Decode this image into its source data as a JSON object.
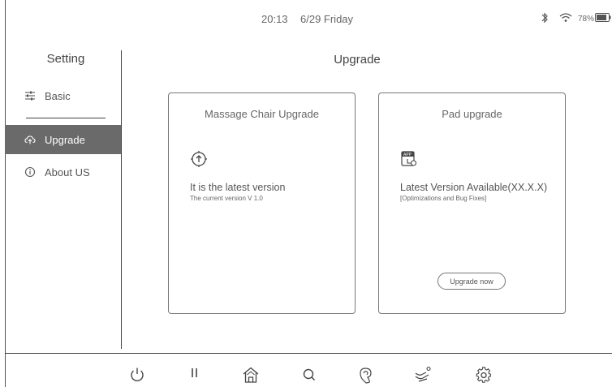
{
  "status": {
    "time": "20:13",
    "date": "6/29 Friday",
    "battery": "78%"
  },
  "sidebar": {
    "title": "Setting",
    "items": [
      {
        "label": "Basic",
        "icon": "sliders-icon"
      },
      {
        "label": "Upgrade",
        "icon": "cloud-upgrade-icon",
        "selected": true
      },
      {
        "label": "About US",
        "icon": "info-icon"
      }
    ]
  },
  "main": {
    "title": "Upgrade",
    "chair_card": {
      "title": "Massage Chair Upgrade",
      "status": "It is the latest version",
      "version": "The current version V 1.0"
    },
    "pad_card": {
      "title": "Pad upgrade",
      "status": "Latest Version Available(XX.X.X)",
      "detail": "[Optimizations and Bug Fixes]",
      "button": "Upgrade now"
    }
  },
  "bottom_bar": [
    "power-icon",
    "pause-icon",
    "home-icon",
    "search-icon",
    "massage-hand-icon",
    "recline-icon",
    "settings-gear-icon"
  ],
  "colors": {
    "selected_bg": "#6a6a6a",
    "line": "#444444"
  }
}
